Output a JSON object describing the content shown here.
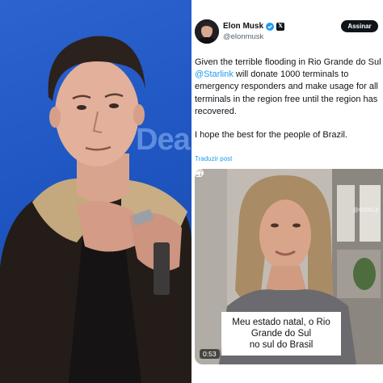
{
  "photo": {
    "background_text": "Deal"
  },
  "tweet": {
    "display_name": "Elon Musk",
    "handle": "@elonmusk",
    "subscribe_label": "Assinar",
    "body_lines": [
      "Given the terrible flooding in Rio Grande do Sul",
      " will donate 1000 terminals to",
      "emergency responders and make usage for all",
      "terminals in the region free until the region has",
      "recovered."
    ],
    "mention": "@Starlink",
    "second_paragraph": "I hope the best for the people of Brazil.",
    "translate_label": "Traduzir post",
    "accent_color": "#1d9bf0"
  },
  "video": {
    "caption_lines": [
      "Meu estado natal, o Rio",
      "Grande do Sul",
      "no sul do Brasil"
    ],
    "duration": "0:53",
    "watermark": "@GISELE"
  },
  "icons": [
    "verified-icon",
    "x-logo-icon",
    "instagram-icon",
    "mute-icon"
  ]
}
